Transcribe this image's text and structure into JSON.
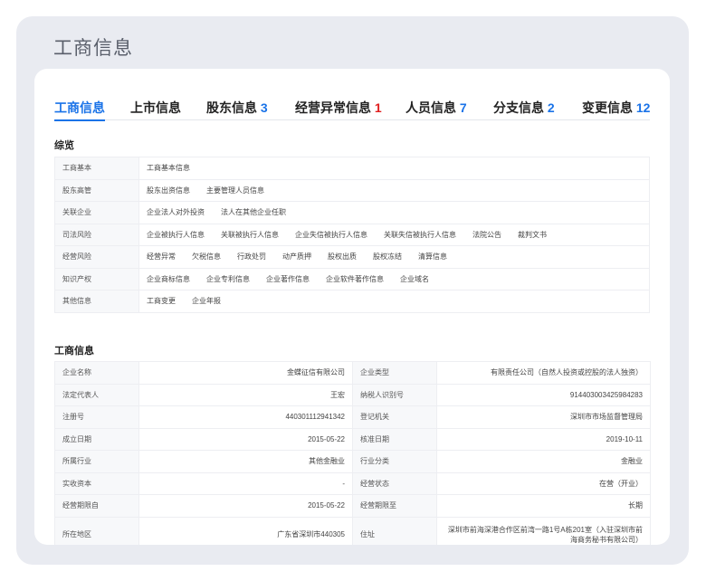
{
  "page_title": "工商信息",
  "tabs": [
    {
      "label": "工商信息",
      "count": ""
    },
    {
      "label": "上市信息",
      "count": ""
    },
    {
      "label": "股东信息",
      "count": "3"
    },
    {
      "label": "经营异常信息",
      "count": "1"
    },
    {
      "label": "人员信息",
      "count": "7"
    },
    {
      "label": "分支信息",
      "count": "2"
    },
    {
      "label": "变更信息",
      "count": "12"
    }
  ],
  "overview": {
    "title": "综览",
    "rows": [
      {
        "key": "工商基本",
        "links": [
          "工商基本信息"
        ]
      },
      {
        "key": "股东高管",
        "links": [
          "股东出资信息",
          "主要管理人员信息"
        ]
      },
      {
        "key": "关联企业",
        "links": [
          "企业法人对外投资",
          "法人在其他企业任职"
        ]
      },
      {
        "key": "司法风险",
        "links": [
          "企业被执行人信息",
          "关联被执行人信息",
          "企业失信被执行人信息",
          "关联失信被执行人信息",
          "法院公告",
          "裁判文书"
        ]
      },
      {
        "key": "经营风险",
        "links": [
          "经营异常",
          "欠税信息",
          "行政处罚",
          "动产质押",
          "股权出质",
          "股权冻结",
          "清算信息"
        ]
      },
      {
        "key": "知识产权",
        "links": [
          "企业商标信息",
          "企业专利信息",
          "企业著作信息",
          "企业软件著作信息",
          "企业域名"
        ]
      },
      {
        "key": "其他信息",
        "links": [
          "工商变更",
          "企业年报"
        ]
      }
    ]
  },
  "business_info": {
    "title": "工商信息",
    "rows": [
      {
        "k1": "企业名称",
        "v1": "金蝶征信有限公司",
        "k2": "企业类型",
        "v2": "有限责任公司（自然人投资或控股的法人独资）"
      },
      {
        "k1": "法定代表人",
        "v1": "王宏",
        "k2": "纳税人识别号",
        "v2": "914403003425984283"
      },
      {
        "k1": "注册号",
        "v1": "440301112941342",
        "k2": "登记机关",
        "v2": "深圳市市场监督管理局"
      },
      {
        "k1": "成立日期",
        "v1": "2015-05-22",
        "k2": "核准日期",
        "v2": "2019-10-11"
      },
      {
        "k1": "所属行业",
        "v1": "其他金融业",
        "k2": "行业分类",
        "v2": "金融业"
      },
      {
        "k1": "实收资本",
        "v1": "-",
        "k2": "经营状态",
        "v2": "在营（开业）"
      },
      {
        "k1": "经营期限自",
        "v1": "2015-05-22",
        "k2": "经营期限至",
        "v2": "长期"
      },
      {
        "k1": "所在地区",
        "v1": "广东省深圳市440305",
        "k2": "住址",
        "v2": "深圳市前海深港合作区前湾一路1号A栋201室（入驻深圳市前海商务秘书有限公司）"
      }
    ]
  }
}
